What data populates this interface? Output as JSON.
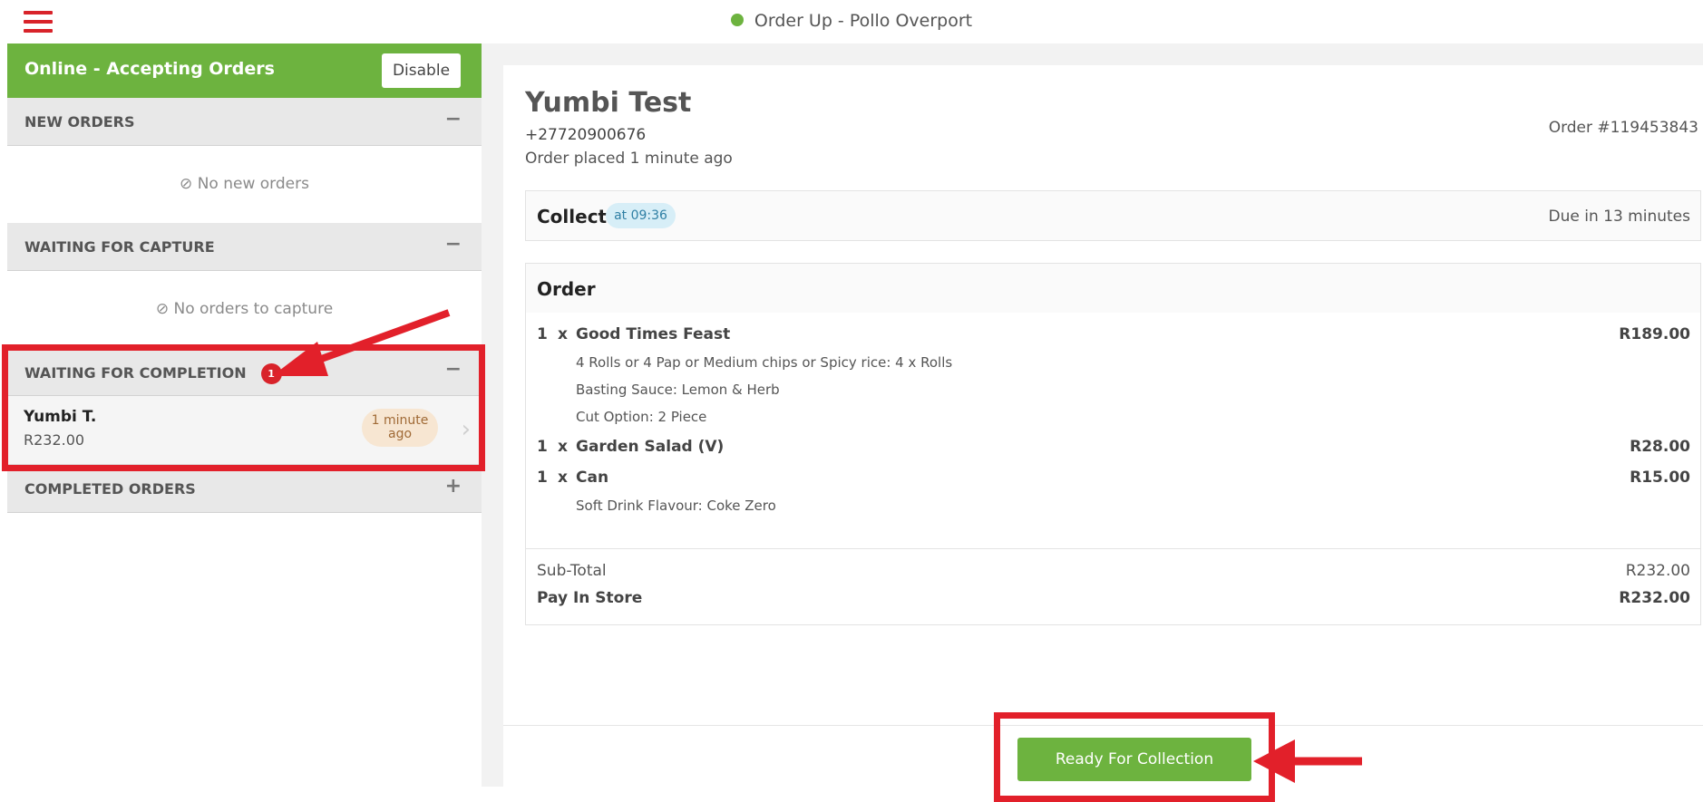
{
  "header": {
    "title": "Order Up - Pollo Overport",
    "status_color": "#6db33f"
  },
  "sidebar": {
    "status_label": "Online - Accepting Orders",
    "disable_label": "Disable",
    "sections": {
      "new_orders": {
        "title": "NEW ORDERS",
        "toggle": "−",
        "empty": "No new orders"
      },
      "waiting_capture": {
        "title": "WAITING FOR CAPTURE",
        "toggle": "−",
        "empty": "No orders to capture"
      },
      "waiting_completion": {
        "title": "WAITING FOR COMPLETION",
        "toggle": "−",
        "badge": "1",
        "orders": [
          {
            "name": "Yumbi T.",
            "amount": "R232.00",
            "time_line1": "1 minute",
            "time_line2": "ago"
          }
        ]
      },
      "completed": {
        "title": "COMPLETED ORDERS",
        "toggle": "+"
      }
    }
  },
  "order": {
    "customer_name": "Yumbi Test",
    "phone": "+27720900676",
    "placed": "Order placed 1 minute ago",
    "number": "Order #119453843",
    "collect_label": "Collect",
    "collect_time": "at 09:36",
    "due": "Due in 13 minutes",
    "section_title": "Order",
    "items": [
      {
        "qty": "1",
        "x": "x",
        "name": "Good Times Feast",
        "price": "R189.00",
        "mods": [
          "4 Rolls or 4 Pap or Medium chips or Spicy rice: 4 x Rolls",
          "Basting Sauce: Lemon & Herb",
          "Cut Option: 2 Piece"
        ]
      },
      {
        "qty": "1",
        "x": "x",
        "name": "Garden Salad (V)",
        "price": "R28.00"
      },
      {
        "qty": "1",
        "x": "x",
        "name": "Can",
        "price": "R15.00",
        "mods": [
          "Soft Drink Flavour: Coke Zero"
        ]
      }
    ],
    "subtotal_label": "Sub-Total",
    "subtotal_value": "R232.00",
    "pay_label": "Pay In Store",
    "pay_value": "R232.00"
  },
  "footer": {
    "ready_label": "Ready For Collection"
  },
  "annotation_color": "#e2202a"
}
